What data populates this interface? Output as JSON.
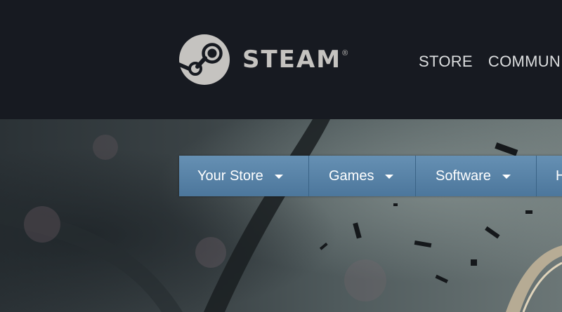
{
  "header": {
    "logo_word": "STEAM",
    "logo_reg": "®",
    "nav": [
      {
        "label": "STORE"
      },
      {
        "label": "COMMUNITY"
      }
    ]
  },
  "store_nav": {
    "tabs": [
      {
        "label": "Your Store",
        "has_dropdown": true
      },
      {
        "label": "Games",
        "has_dropdown": true
      },
      {
        "label": "Software",
        "has_dropdown": true
      },
      {
        "label": "Hardware",
        "has_dropdown": true
      }
    ]
  },
  "colors": {
    "header_bg": "#171a21",
    "nav_text": "#dcdedf",
    "logo_text": "#c5c3c0",
    "store_nav_bg": "#4f7fa8"
  },
  "icons": {
    "logo": "steam-logo-icon",
    "dropdown": "chevron-down-icon"
  }
}
